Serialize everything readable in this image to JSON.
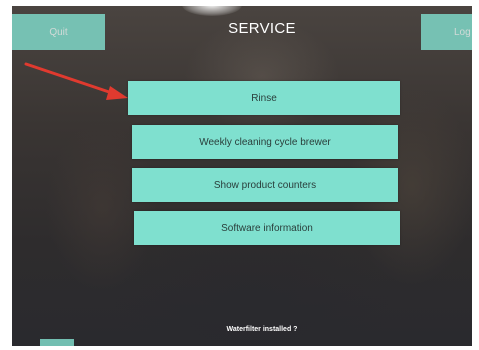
{
  "header": {
    "quit_label": "Quit",
    "title": "SERVICE",
    "log_label": "Log"
  },
  "menu": {
    "items": [
      {
        "label": "Rinse"
      },
      {
        "label": "Weekly cleaning cycle brewer"
      },
      {
        "label": "Show product counters"
      },
      {
        "label": "Software information"
      }
    ]
  },
  "footer": {
    "status_text": "Waterfilter installed ?"
  },
  "colors": {
    "button_teal": "#7fe0cf",
    "screen_dark": "#3a3533",
    "annotation_arrow": "#e03a2f"
  }
}
